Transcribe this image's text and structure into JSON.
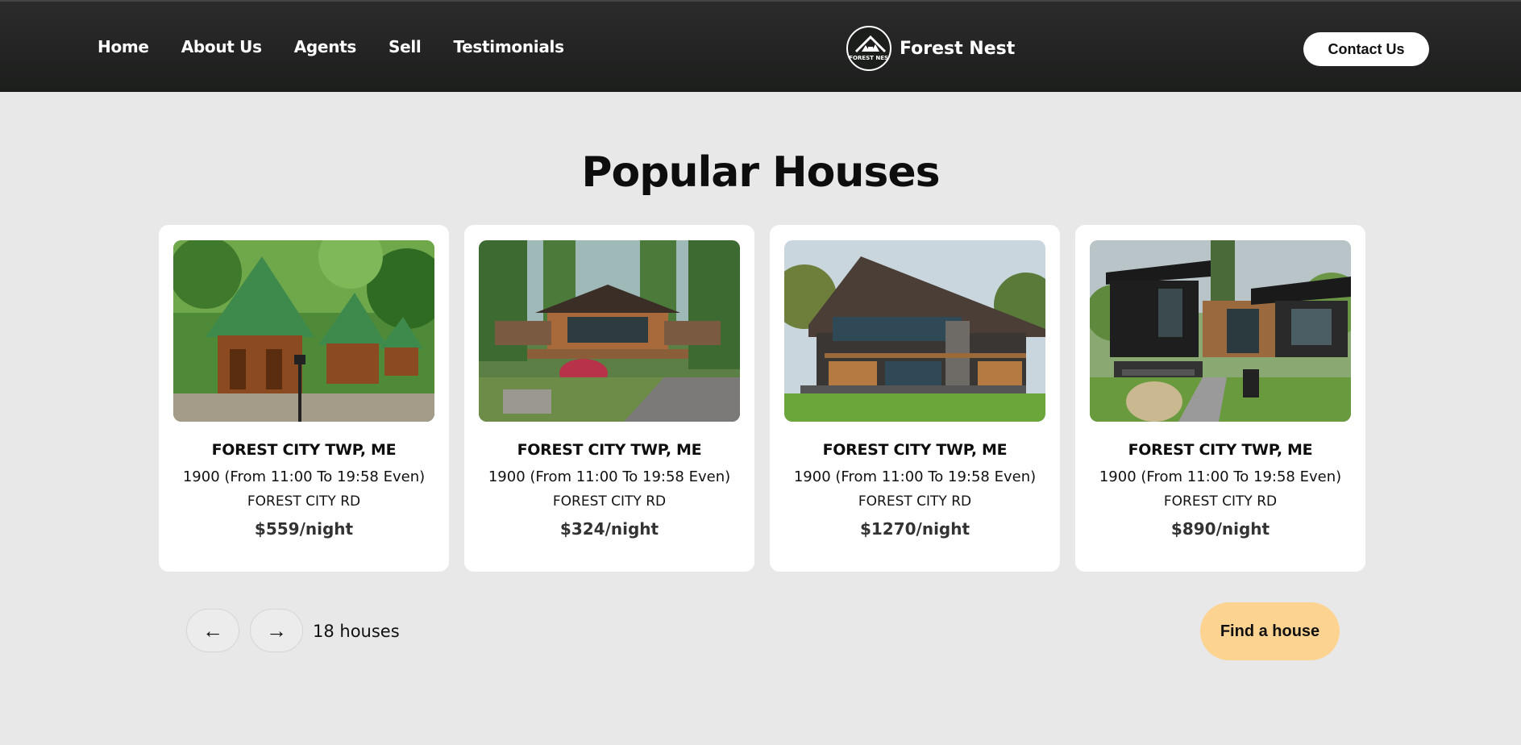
{
  "nav": {
    "items": [
      "Home",
      "About Us",
      "Agents",
      "Sell",
      "Testimonials"
    ]
  },
  "brand": {
    "logo_text": "FOREST NEST",
    "name": "Forest Nest"
  },
  "header": {
    "contact_label": "Contact Us"
  },
  "main": {
    "title": "Popular Houses",
    "cards": [
      {
        "location": "FOREST CITY TWP, ME",
        "hours": "1900 (From 11:00 To 19:58 Even)",
        "street": "FOREST CITY RD",
        "price": "$559/night"
      },
      {
        "location": "FOREST CITY TWP, ME",
        "hours": "1900 (From 11:00 To 19:58 Even)",
        "street": "FOREST CITY RD",
        "price": "$324/night"
      },
      {
        "location": "FOREST CITY TWP, ME",
        "hours": "1900 (From 11:00 To 19:58 Even)",
        "street": "FOREST CITY RD",
        "price": "$1270/night"
      },
      {
        "location": "FOREST CITY TWP, ME",
        "hours": "1900 (From 11:00 To 19:58 Even)",
        "street": "FOREST CITY RD",
        "price": "$890/night"
      }
    ]
  },
  "pager": {
    "prev_icon": "←",
    "next_icon": "→",
    "count": "18 houses"
  },
  "cta": {
    "find_label": "Find a house"
  },
  "colors": {
    "header_bg": "#1c1e1c",
    "page_bg": "#e8e8e8",
    "find_button": "#fdd391"
  }
}
